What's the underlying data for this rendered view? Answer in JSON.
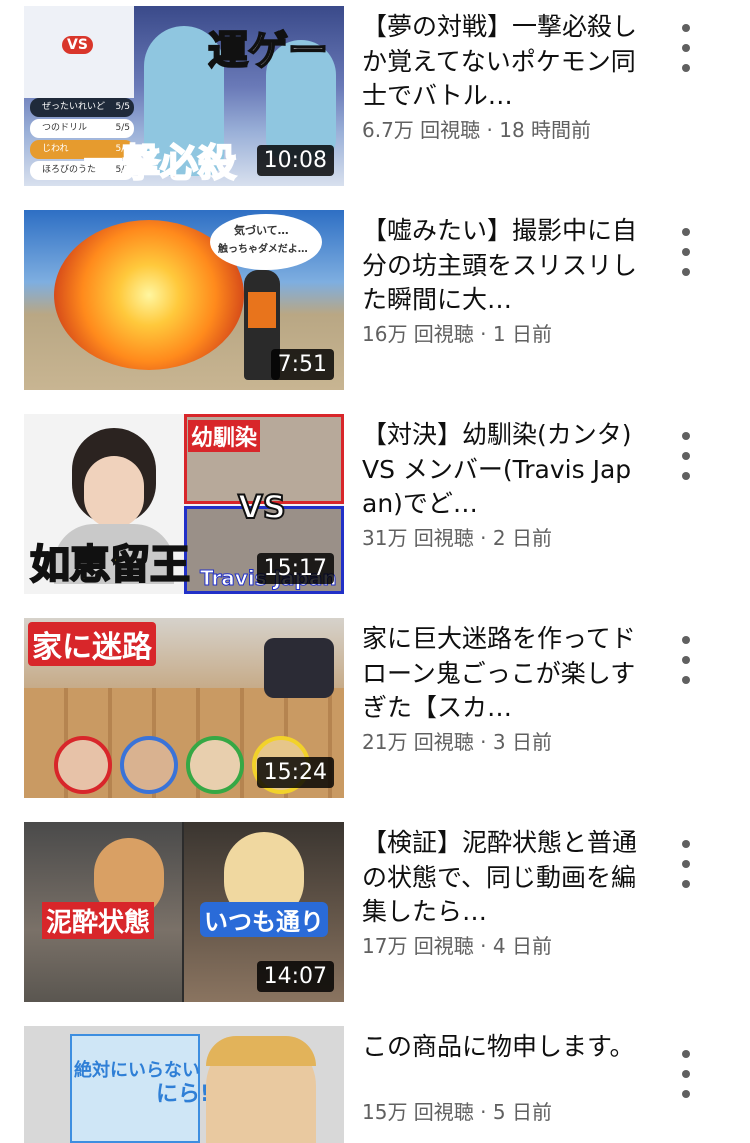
{
  "videos": [
    {
      "title": "【夢の対戦】一撃必殺しか覚えてないポケモン同士でバトル…",
      "views": "6.7万 回視聴",
      "age": "18 時間前",
      "duration": "10:08",
      "thumb_text": [
        "運ゲー",
        "一撃必殺",
        "VS",
        "ぜったいれいど",
        "つのドリル",
        "じわれ",
        "ほろびのうた",
        "5/5",
        "5/5",
        "5/5",
        "5/5"
      ]
    },
    {
      "title": "【嘘みたい】撮影中に自分の坊主頭をスリスリした瞬間に大…",
      "views": "16万 回視聴",
      "age": "1 日前",
      "duration": "7:51",
      "thumb_text": [
        "気づいて…",
        "触っちゃダメだよ…"
      ]
    },
    {
      "title": "【対決】幼馴染(カンタ) VS メンバー(Travis Japan)でど…",
      "views": "31万 回視聴",
      "age": "2 日前",
      "duration": "15:17",
      "thumb_text": [
        "如恵留王",
        "幼馴染",
        "VS",
        "Travis Japan"
      ]
    },
    {
      "title": "家に巨大迷路を作ってドローン鬼ごっこが楽しすぎた【スカ…",
      "views": "21万 回視聴",
      "age": "3 日前",
      "duration": "15:24",
      "thumb_text": [
        "家に迷路"
      ]
    },
    {
      "title": "【検証】泥酔状態と普通の状態で、同じ動画を編集したら…",
      "views": "17万 回視聴",
      "age": "4 日前",
      "duration": "14:07",
      "thumb_text": [
        "泥酔状態",
        "いつも通り"
      ]
    },
    {
      "title": "この商品に物申します。",
      "views": "15万 回視聴",
      "age": "5 日前",
      "duration": "",
      "thumb_text": [
        "絶対にいらない",
        "にら!?"
      ]
    }
  ],
  "meta_separator": " · ",
  "colors": {
    "title": "#0f0f0f",
    "meta": "#606060",
    "duration_bg": "#000000"
  },
  "icons": {
    "menu": "more-vert-icon"
  }
}
